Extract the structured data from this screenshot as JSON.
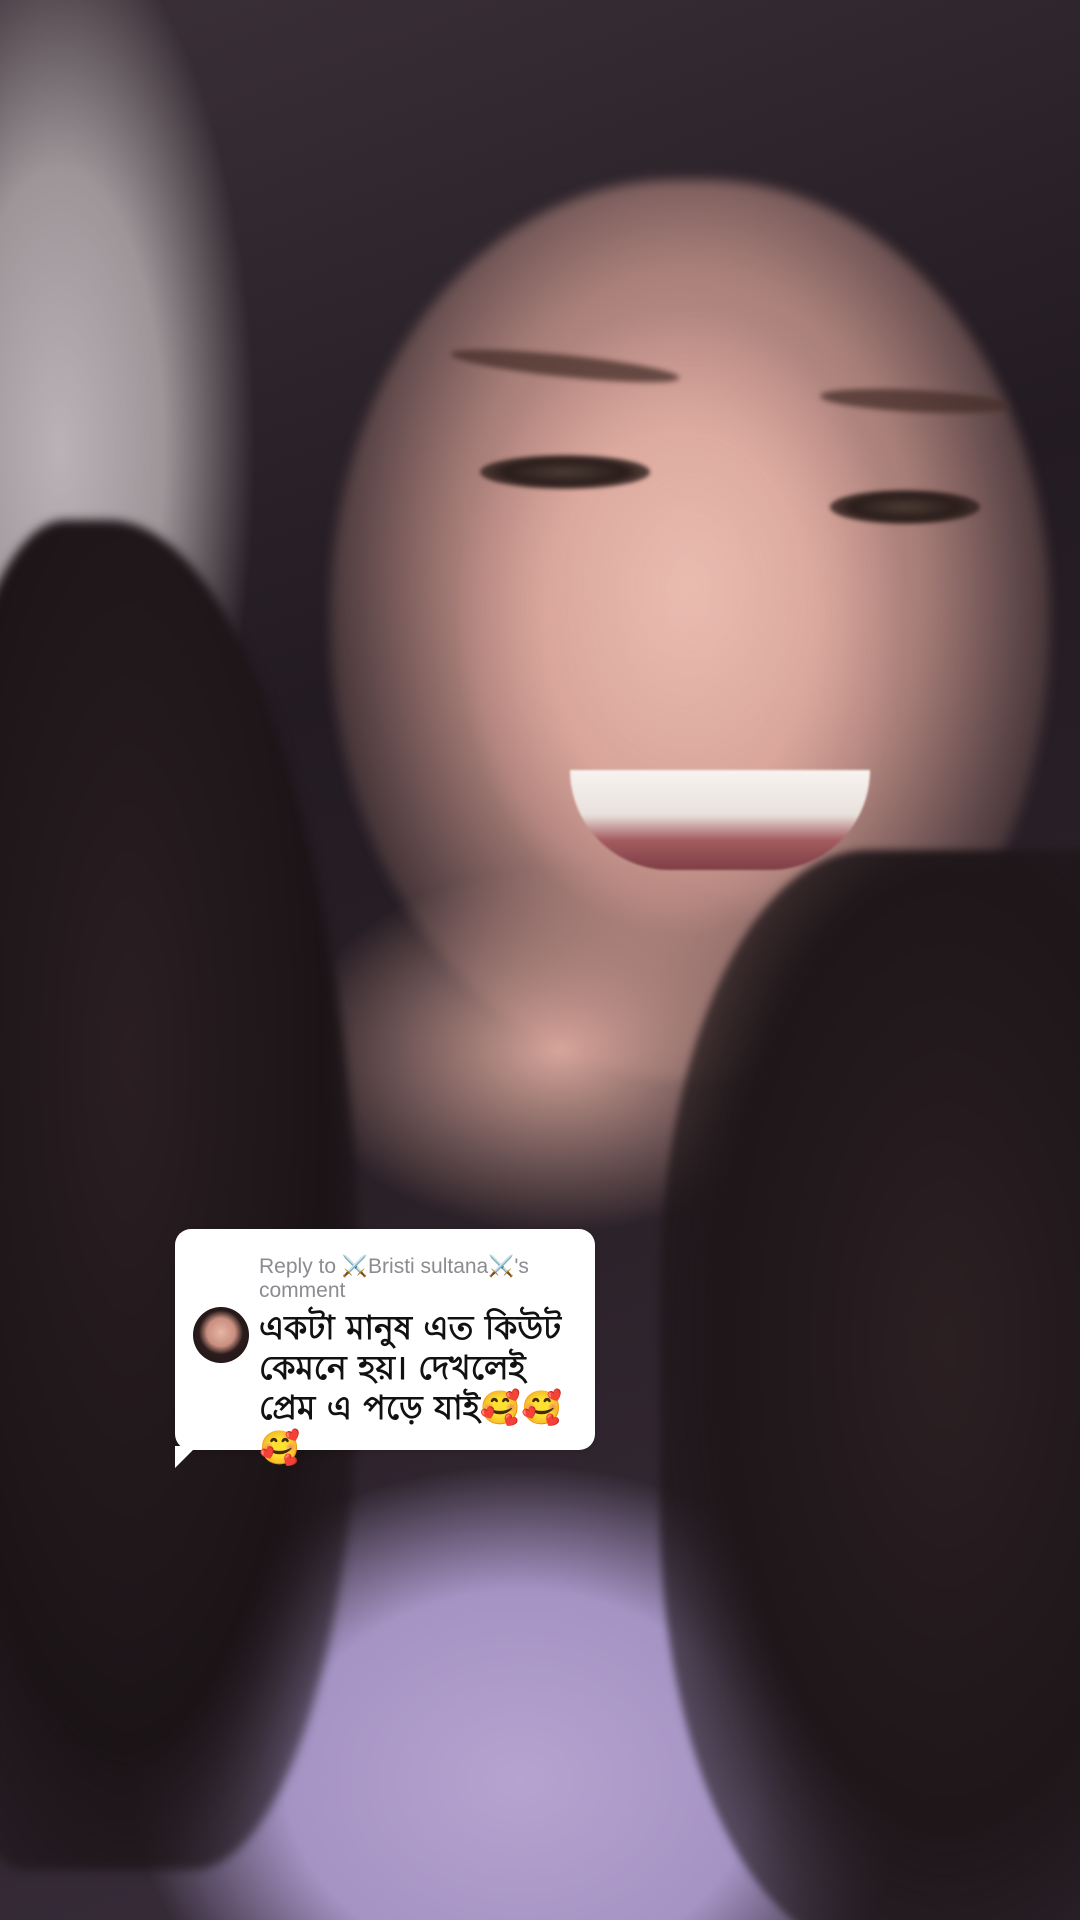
{
  "reply_sticker": {
    "header_prefix": "Reply to ",
    "commenter_name": "⚔️Bristi sultana⚔️",
    "header_suffix": "'s comment",
    "comment_text": "একটা মানুষ এত কিউট কেমনে হয়। দেখলেই প্রেম এ পড়ে যাই🥰🥰🥰"
  },
  "colors": {
    "sticker_bg": "#ffffff",
    "header_text": "#8b8b91",
    "comment_text": "#111111"
  },
  "icons": {
    "commenter_avatar": "avatar-photo"
  }
}
